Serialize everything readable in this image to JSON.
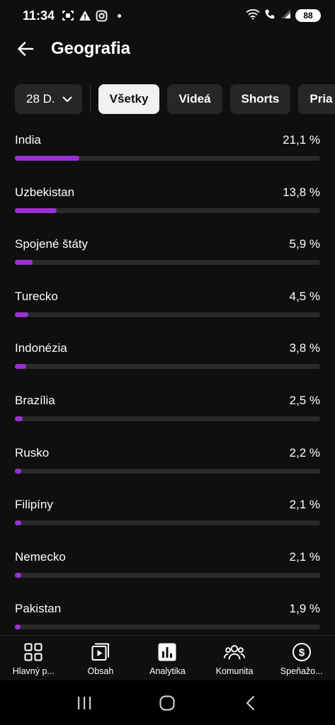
{
  "status_bar": {
    "time": "11:34",
    "battery": "88"
  },
  "header": {
    "title": "Geografia"
  },
  "filters": {
    "period": "28 D.",
    "chips": [
      {
        "label": "Všetky",
        "active": true
      },
      {
        "label": "Videá",
        "active": false
      },
      {
        "label": "Shorts",
        "active": false
      },
      {
        "label": "Pria",
        "active": false
      }
    ]
  },
  "countries": [
    {
      "name": "India",
      "value": "21,1 %",
      "fraction": 0.211
    },
    {
      "name": "Uzbekistan",
      "value": "13,8 %",
      "fraction": 0.138
    },
    {
      "name": "Spojené štáty",
      "value": "5,9 %",
      "fraction": 0.059
    },
    {
      "name": "Turecko",
      "value": "4,5 %",
      "fraction": 0.045
    },
    {
      "name": "Indonézia",
      "value": "3,8 %",
      "fraction": 0.038
    },
    {
      "name": "Brazília",
      "value": "2,5 %",
      "fraction": 0.025
    },
    {
      "name": "Rusko",
      "value": "2,2 %",
      "fraction": 0.022
    },
    {
      "name": "Filipíny",
      "value": "2,1 %",
      "fraction": 0.021
    },
    {
      "name": "Nemecko",
      "value": "2,1 %",
      "fraction": 0.021
    },
    {
      "name": "Pakistan",
      "value": "1,9 %",
      "fraction": 0.019
    }
  ],
  "bottom_nav": [
    {
      "label": "Hlavný p...",
      "icon": "dashboard-icon"
    },
    {
      "label": "Obsah",
      "icon": "content-icon"
    },
    {
      "label": "Analytika",
      "icon": "analytics-icon"
    },
    {
      "label": "Komunita",
      "icon": "community-icon"
    },
    {
      "label": "Speňažo...",
      "icon": "monetization-icon"
    }
  ],
  "colors": {
    "background": "#0f0f0f",
    "bar_fill": "#9b30d6",
    "bar_track": "#2a2a2a",
    "chip_active": "#f1f1f1",
    "chip": "#272727"
  }
}
